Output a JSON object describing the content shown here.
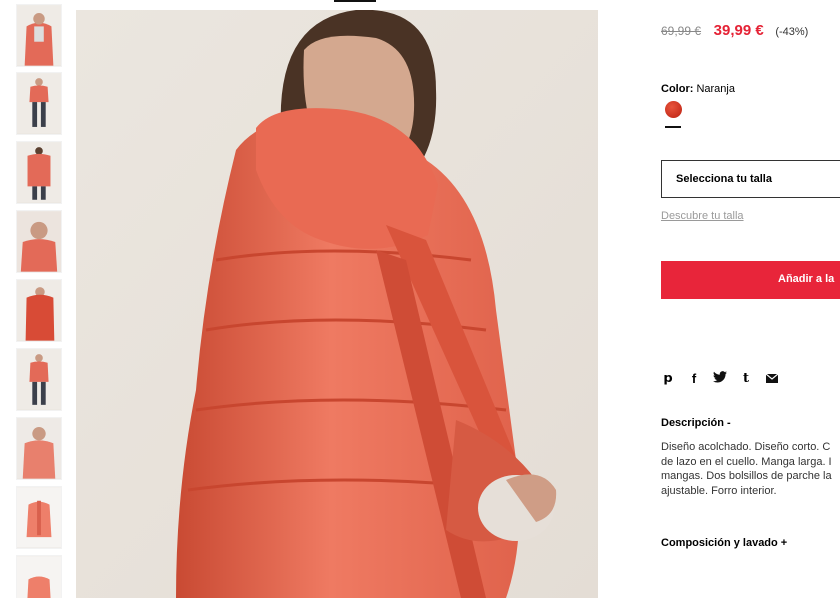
{
  "thumbnails": [
    {
      "label": "thumb-1"
    },
    {
      "label": "thumb-2"
    },
    {
      "label": "thumb-3"
    },
    {
      "label": "thumb-4"
    },
    {
      "label": "thumb-5"
    },
    {
      "label": "thumb-6"
    },
    {
      "label": "thumb-7"
    },
    {
      "label": "thumb-8"
    },
    {
      "label": "thumb-9"
    }
  ],
  "product": {
    "old_price": "69,99 €",
    "price": "39,99 €",
    "discount": "(-43%)",
    "color_label": "Color:",
    "color_value": "Naranja",
    "swatch_color": "#d0341f",
    "size_select": "Selecciona tu talla",
    "size_guide": "Descubre tu talla",
    "add_button": "Añadir a la",
    "accent_color": "#e8253a"
  },
  "share_icons": [
    "pinterest-icon",
    "facebook-icon",
    "twitter-icon",
    "tumblr-icon",
    "email-icon"
  ],
  "description": {
    "title": "Descripción -",
    "lines": [
      "Diseño acolchado. Diseño corto. C",
      "de lazo en el cuello. Manga larga. I",
      "mangas. Dos bolsillos de parche la",
      "ajustable. Forro interior."
    ]
  },
  "composition": {
    "title": "Composición y lavado +"
  }
}
